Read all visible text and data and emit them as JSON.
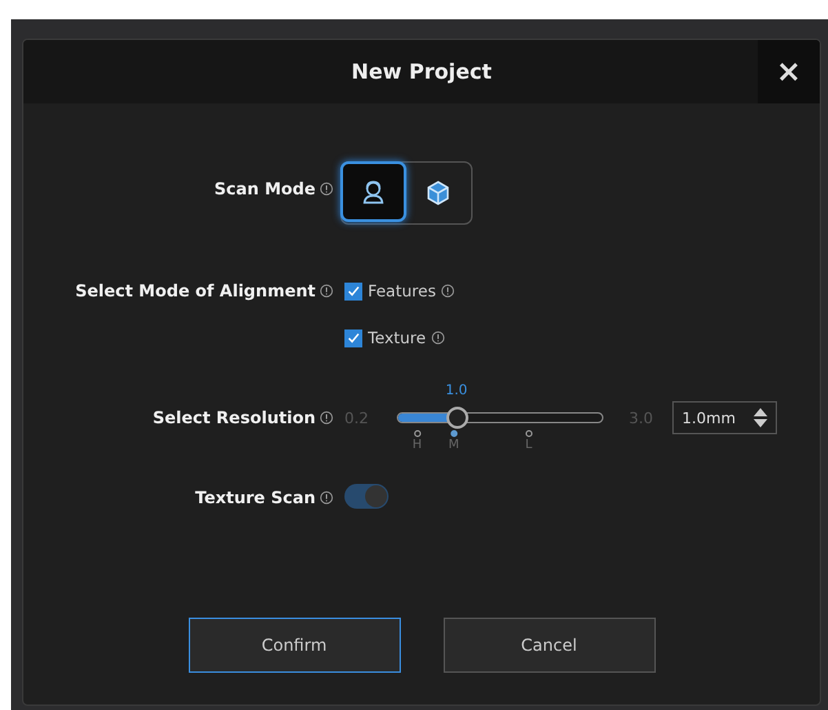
{
  "dialog": {
    "title": "New Project",
    "close": "×"
  },
  "scan_mode": {
    "label": "Scan Mode",
    "options": [
      {
        "kind": "person",
        "selected": true
      },
      {
        "kind": "cube",
        "selected": false
      }
    ]
  },
  "alignment": {
    "label": "Select Mode of Alignment",
    "options": [
      {
        "label": "Features",
        "checked": true
      },
      {
        "label": "Texture",
        "checked": true
      }
    ]
  },
  "resolution": {
    "label": "Select Resolution",
    "min": "0.2",
    "max": "3.0",
    "reading": "1.0",
    "level": 0.286,
    "marks": [
      {
        "label": "H",
        "selected": false
      },
      {
        "label": "M",
        "selected": true
      },
      {
        "label": "L",
        "selected": false
      }
    ],
    "value": "1.0mm"
  },
  "texture_scan": {
    "label": "Texture Scan",
    "on": true
  },
  "buttons": [
    {
      "label": "Confirm",
      "selected": true
    },
    {
      "label": "Cancel",
      "selected": false
    }
  ]
}
